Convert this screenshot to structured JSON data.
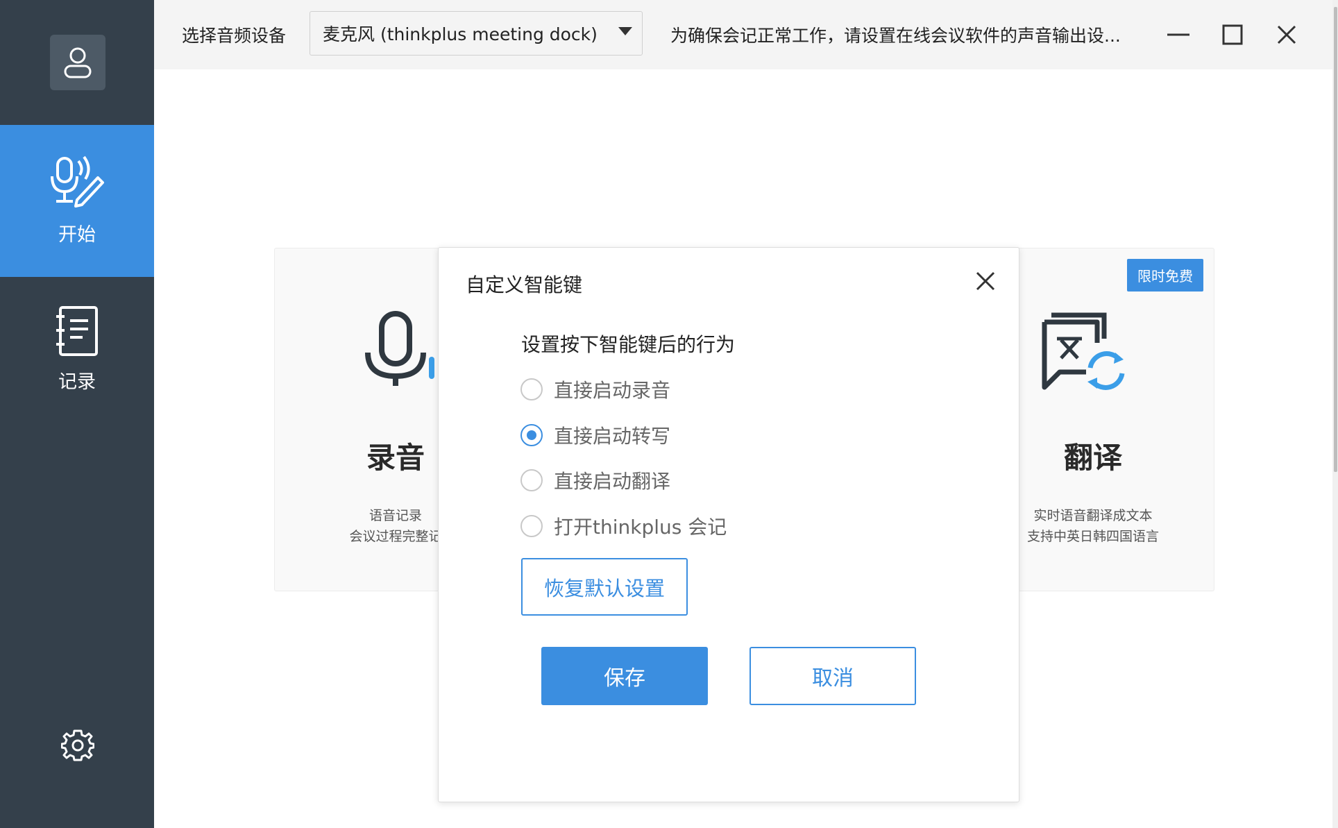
{
  "sidebar": {
    "items": [
      {
        "label": "开始",
        "icon": "microphone-pen-icon",
        "active": true
      },
      {
        "label": "记录",
        "icon": "notebook-icon",
        "active": false
      }
    ]
  },
  "topbar": {
    "device_label": "选择音频设备",
    "device_selected": "麦克风 (thinkplus meeting dock)",
    "hint": "为确保会记正常工作，请设置在线会议软件的声音输出设..."
  },
  "cards": {
    "record": {
      "title": "录音",
      "desc_line1": "语音记录",
      "desc_line2": "会议过程完整记"
    },
    "translate": {
      "badge": "限时免费",
      "title": "翻译",
      "desc_line1": "实时语音翻译成文本",
      "desc_line2": "支持中英日韩四国语言"
    }
  },
  "dialog": {
    "title": "自定义智能键",
    "question": "设置按下智能键后的行为",
    "options": [
      {
        "label": "直接启动录音",
        "checked": false
      },
      {
        "label": "直接启动转写",
        "checked": true
      },
      {
        "label": "直接启动翻译",
        "checked": false
      },
      {
        "label": "打开thinkplus 会记",
        "checked": false
      }
    ],
    "restore_label": "恢复默认设置",
    "save_label": "保存",
    "cancel_label": "取消"
  },
  "colors": {
    "accent": "#3b8ee0",
    "sidebar_bg": "#34404b"
  }
}
